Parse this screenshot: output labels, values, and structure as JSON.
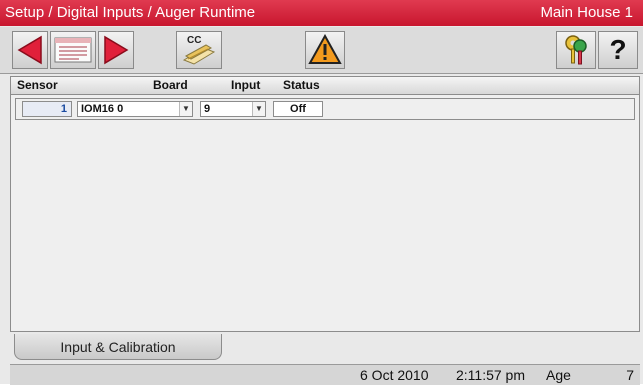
{
  "title": {
    "path": "Setup / Digital Inputs / Auger Runtime",
    "house": "Main House 1"
  },
  "toolbar": {
    "buttons": [
      {
        "name": "previous",
        "icon": "left-arrow-icon"
      },
      {
        "name": "list-view",
        "icon": "list-card-icon"
      },
      {
        "name": "next",
        "icon": "right-arrow-icon"
      },
      {
        "name": "cc",
        "icon": "cc-pencil-icon",
        "label": "CC"
      },
      {
        "name": "alarm",
        "icon": "warning-triangle-icon"
      },
      {
        "name": "security",
        "icon": "keys-icon"
      },
      {
        "name": "help",
        "icon": "question-icon",
        "label": "?"
      }
    ]
  },
  "table": {
    "headers": [
      "Sensor",
      "Board",
      "Input",
      "Status"
    ],
    "rows": [
      {
        "sensor": "1",
        "board": "IOM16 0",
        "input": "9",
        "status": "Off"
      }
    ]
  },
  "tabs": [
    {
      "label": "Input & Calibration"
    }
  ],
  "status_bar": {
    "date": "6 Oct 2010",
    "time": "2:11:57 pm",
    "age_label": "Age",
    "age_value": "7"
  },
  "colors": {
    "title_bar": "#d42a42",
    "arrow_red": "#e0203a",
    "warning_orange": "#f39a1d"
  }
}
